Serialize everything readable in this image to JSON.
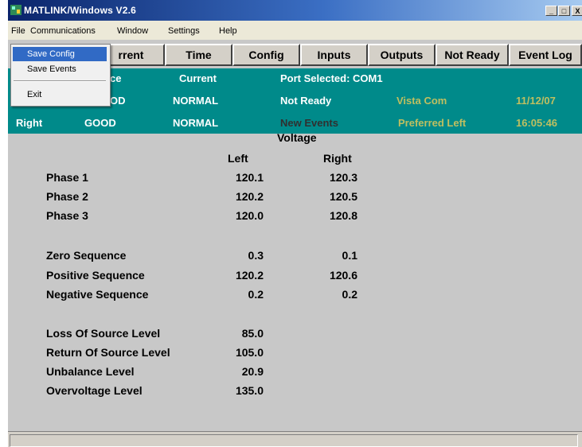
{
  "window": {
    "title": "MATLINK/Windows V2.6",
    "minimize": "_",
    "maximize": "□",
    "close": "X"
  },
  "menu": [
    "File",
    "Communications",
    "Window",
    "Settings",
    "Help"
  ],
  "file_menu": {
    "items": [
      "Save Config",
      "Save Events",
      "Exit"
    ],
    "selected": "Save Config"
  },
  "tabs": [
    "Current",
    "Time",
    "Config",
    "Inputs",
    "Outputs",
    "Not Ready",
    "Event Log"
  ],
  "tab_partial": {
    "Current": "rrent"
  },
  "status": {
    "row1": {
      "source_partial": "ce",
      "current": "Current",
      "port": "Port Selected: COM1"
    },
    "row2": {
      "source_partial": "OD",
      "current": "NORMAL",
      "state": "Not Ready",
      "device": "Vista Com",
      "date": "11/12/07"
    },
    "row3": {
      "side": "Right",
      "source": "GOOD",
      "current": "NORMAL",
      "events": "New Events",
      "preference": "Preferred Left",
      "time": "16:05:46"
    }
  },
  "voltage": {
    "title": "Voltage",
    "col_left": "Left",
    "col_right": "Right",
    "phases": [
      {
        "label": "Phase 1",
        "left": "120.1",
        "right": "120.3"
      },
      {
        "label": "Phase 2",
        "left": "120.2",
        "right": "120.5"
      },
      {
        "label": "Phase 3",
        "left": "120.0",
        "right": "120.8"
      }
    ],
    "sequences": [
      {
        "label": "Zero Sequence",
        "left": "0.3",
        "right": "0.1"
      },
      {
        "label": "Positive Sequence",
        "left": "120.2",
        "right": "120.6"
      },
      {
        "label": "Negative Sequence",
        "left": "0.2",
        "right": "0.2"
      }
    ],
    "levels": [
      {
        "label": "Loss Of Source Level",
        "left": "85.0"
      },
      {
        "label": "Return Of Source Level",
        "left": "105.0"
      },
      {
        "label": "Unbalance Level",
        "left": "20.9"
      },
      {
        "label": "Overvoltage Level",
        "left": "135.0"
      }
    ]
  },
  "colors": {
    "status_bg": "#008a8a",
    "status_text": "#ffffff",
    "panel_bg": "#c8c8c8",
    "menu_highlight": "#316ac5"
  }
}
